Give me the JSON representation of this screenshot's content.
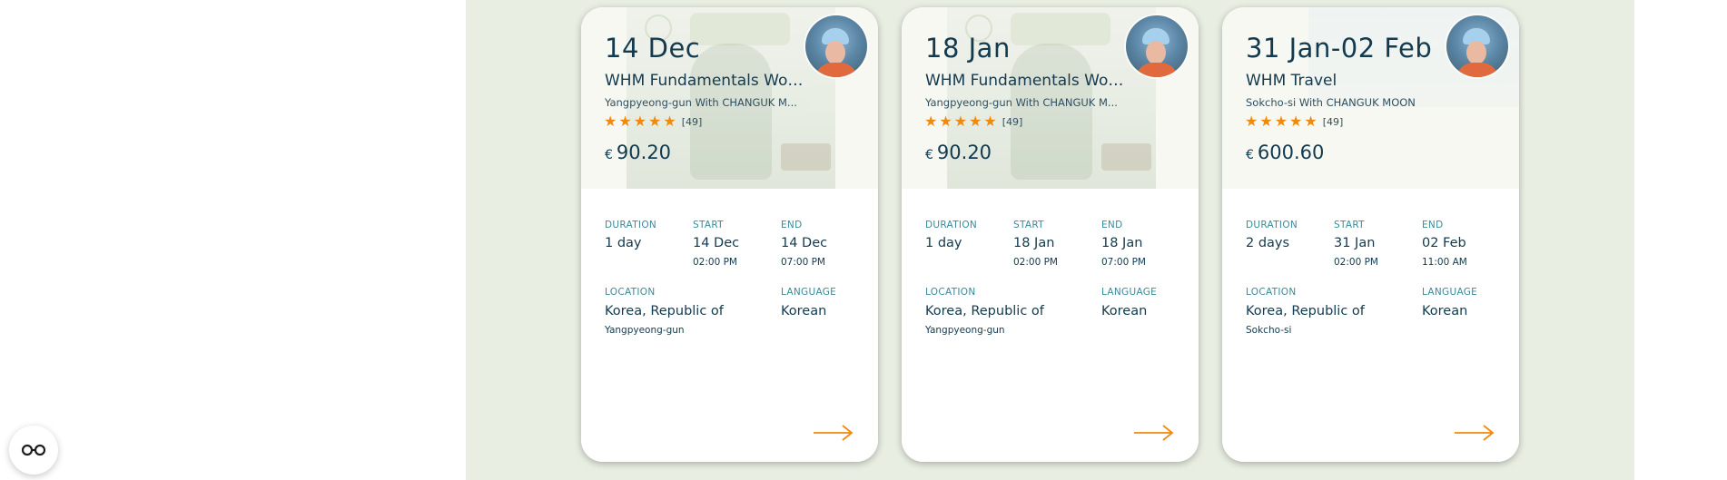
{
  "cards": [
    {
      "date": "14 Dec",
      "title": "WHM Fundamentals Work...",
      "host": "Yangpyeong-gun With CHANGUK M...",
      "rating_stars": 5,
      "reviews": "[49]",
      "currency": "€",
      "price": "90.20",
      "duration_label": "DURATION",
      "duration": "1 day",
      "start_label": "START",
      "start_date": "14 Dec",
      "start_time": "02:00 PM",
      "end_label": "END",
      "end_date": "14 Dec",
      "end_time": "07:00 PM",
      "location_label": "LOCATION",
      "location_country": "Korea, Republic of",
      "location_city": "Yangpyeong-gun",
      "language_label": "LANGUAGE",
      "language": "Korean"
    },
    {
      "date": "18 Jan",
      "title": "WHM Fundamentals Work...",
      "host": "Yangpyeong-gun With CHANGUK M...",
      "rating_stars": 5,
      "reviews": "[49]",
      "currency": "€",
      "price": "90.20",
      "duration_label": "DURATION",
      "duration": "1 day",
      "start_label": "START",
      "start_date": "18 Jan",
      "start_time": "02:00 PM",
      "end_label": "END",
      "end_date": "18 Jan",
      "end_time": "07:00 PM",
      "location_label": "LOCATION",
      "location_country": "Korea, Republic of",
      "location_city": "Yangpyeong-gun",
      "language_label": "LANGUAGE",
      "language": "Korean"
    },
    {
      "date": "31 Jan-02 Feb",
      "title": "WHM Travel",
      "host": "Sokcho-si With CHANGUK MOON",
      "rating_stars": 5,
      "reviews": "[49]",
      "currency": "€",
      "price": "600.60",
      "duration_label": "DURATION",
      "duration": "2 days",
      "start_label": "START",
      "start_date": "31 Jan",
      "start_time": "02:00 PM",
      "end_label": "END",
      "end_date": "02 Feb",
      "end_time": "11:00 AM",
      "location_label": "LOCATION",
      "location_country": "Korea, Republic of",
      "location_city": "Sokcho-si",
      "language_label": "LANGUAGE",
      "language": "Korean"
    }
  ],
  "icons": {
    "star": "star-icon",
    "arrow": "arrow-right-icon",
    "floating": "glasses-icon"
  },
  "colors": {
    "accent": "#f08a0d",
    "label": "#3a8a9a",
    "text": "#133a4e",
    "panel_bg": "#e8eee2"
  }
}
